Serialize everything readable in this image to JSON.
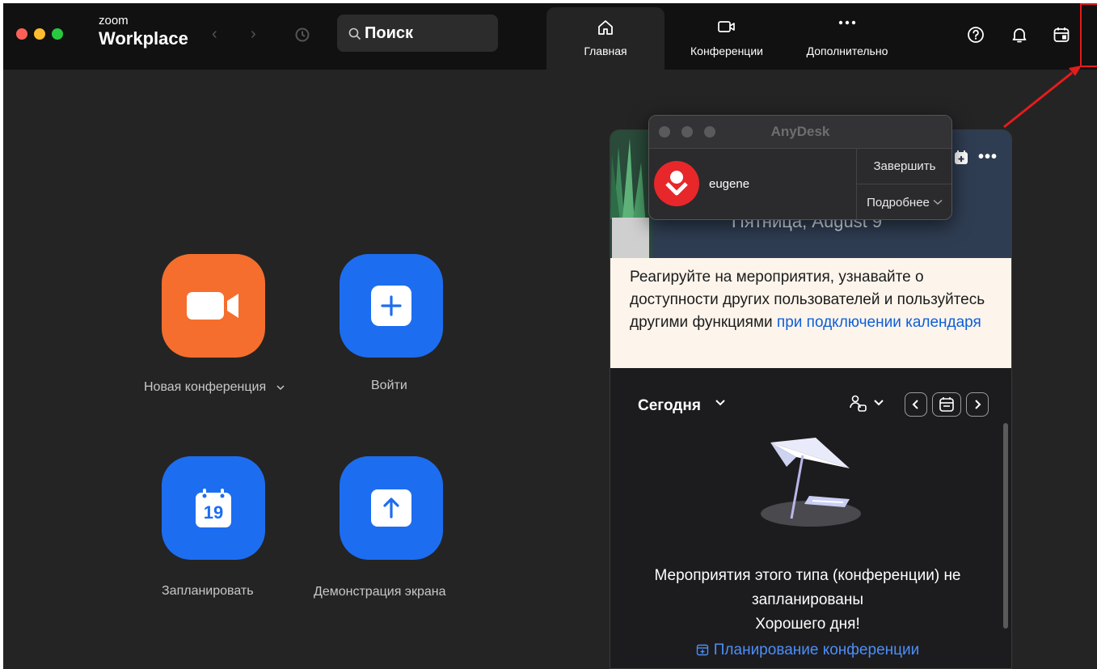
{
  "titlebar": {
    "brand_small": "zoom",
    "brand_big": "Workplace",
    "back_arrow": "‹",
    "forward_arrow": "›",
    "search_label": "Поиск"
  },
  "tabs": [
    {
      "label": "Главная",
      "icon": "home-icon",
      "active": true
    },
    {
      "label": "Конференции",
      "icon": "video-icon",
      "active": false
    },
    {
      "label": "Дополнительно",
      "icon": "more-icon",
      "active": false
    }
  ],
  "right_icons": [
    "help-icon",
    "bell-icon",
    "calendar-panel-icon"
  ],
  "actions": {
    "new_meeting": "Новая конференция",
    "join": "Войти",
    "schedule": "Запланировать",
    "schedule_day": "19",
    "share_screen": "Демонстрация экрана"
  },
  "panel": {
    "header_date": "Пятница, August 9",
    "notice_text": "Реагируйте на мероприятия, узнавайте о доступности других пользователей и пользуйтесь другими функциями ",
    "notice_link": "при подключении календаря",
    "today_label": "Сегодня",
    "empty_line1": "Мероприятия этого типа (конференции) не",
    "empty_line2": "запланированы",
    "empty_line3": "Хорошего дня!",
    "schedule_link": "Планирование конференции"
  },
  "anydesk": {
    "title": "AnyDesk",
    "user": "eugene",
    "end_button": "Завершить",
    "details_button": "Подробнее"
  },
  "colors": {
    "app_bg": "#242424",
    "titlebar_bg": "#111111",
    "orange": "#f56e2d",
    "blue": "#1d6df0",
    "link": "#0e5ed9",
    "annotation_red": "#e41c1c"
  }
}
